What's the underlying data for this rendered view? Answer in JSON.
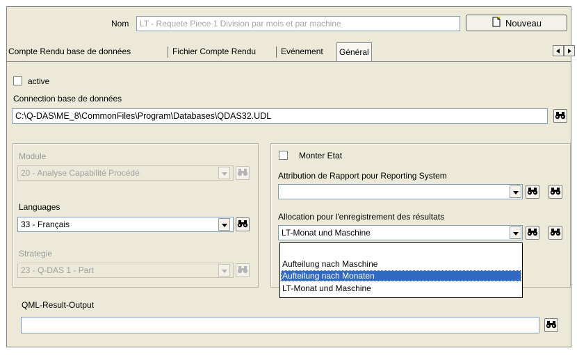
{
  "header": {
    "nom_label": "Nom",
    "nom_value": "LT - Requete Piece 1 Division par mois et par machine",
    "nouveau_label": "Nouveau"
  },
  "tabs": [
    {
      "label": "Compte Rendu base de données"
    },
    {
      "label": "Fichier Compte Rendu"
    },
    {
      "label": "Evénement"
    },
    {
      "label": "Général"
    }
  ],
  "general": {
    "active_label": "active",
    "connection_label": "Connection base de données",
    "connection_value": "C:\\Q-DAS\\ME_8\\CommonFiles\\Program\\Databases\\QDAS32.UDL"
  },
  "left_group": {
    "module_label": "Module",
    "module_value": "20 - Analyse Capabilité Procédé",
    "languages_label": "Languages",
    "languages_value": "33 - Français",
    "strategie_label": "Strategie",
    "strategie_value": "23 - Q-DAS 1 - Part"
  },
  "right_group": {
    "monter_etat_label": "Monter Etat",
    "attribution_label": "Attribution de Rapport pour Reporting System",
    "attribution_value": "",
    "allocation_label": "Allocation pour l'enregistrement des résultats",
    "allocation_value": "LT-Monat und Maschine",
    "allocation_options": [
      {
        "label": ""
      },
      {
        "label": "Aufteilung nach Maschine"
      },
      {
        "label": "Aufteilung nach Monaten"
      },
      {
        "label": "LT-Monat und Maschine"
      }
    ]
  },
  "qml": {
    "label": "QML-Result-Output",
    "value": ""
  },
  "colors": {
    "selection": "#316ac5",
    "panel": "#ece9d8"
  }
}
